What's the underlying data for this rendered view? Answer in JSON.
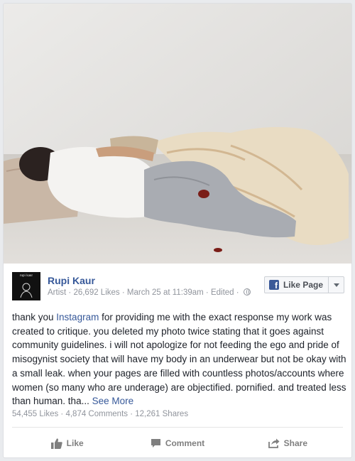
{
  "post": {
    "page_name": "Rupi Kaur",
    "avatar_text": "rupi kaur",
    "meta": {
      "category": "Artist",
      "likes": "26,692 Likes",
      "date": "March 25 at 11:39am",
      "edited": "Edited"
    },
    "like_page_label": "Like Page",
    "text": {
      "part1": "thank you ",
      "link": "Instagram",
      "part2": " for providing me with the exact response my work was created to critique. you deleted my photo twice stating that it goes against community guidelines. i will not apologize for not feeding the ego and pride of misogynist society that will have my body in an underwear but not be okay with a small leak. when your pages are filled with countless photos/accounts where women (so many who are underage) are objectified. pornified. and treated less than human. tha... ",
      "see_more": "See More"
    },
    "counts": {
      "likes": "54,455 Likes",
      "comments": "4,874 Comments",
      "shares": "12,261 Shares"
    },
    "actions": {
      "like": "Like",
      "comment": "Comment",
      "share": "Share"
    }
  },
  "colors": {
    "link": "#365899",
    "meta": "#90949c",
    "facebook": "#3b5998"
  }
}
